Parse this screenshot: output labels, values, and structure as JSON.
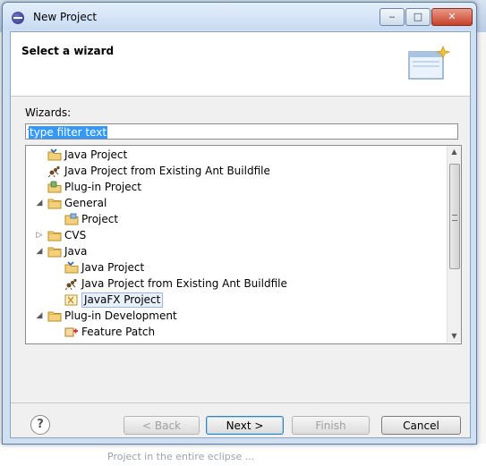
{
  "window": {
    "title": "New Project",
    "controls": {
      "minimize": "‒",
      "maximize": "□",
      "close": "✕"
    }
  },
  "background": {
    "bottom_text": "Project in the entire eclipse ..."
  },
  "header": {
    "title": "Select a wizard"
  },
  "wizards": {
    "label": "Wizards:",
    "filter_value": "type filter text"
  },
  "tree": {
    "items": [
      {
        "label": "Java Project",
        "icon": "java-project-icon",
        "level": 1,
        "expandable": false
      },
      {
        "label": "Java Project from Existing Ant Buildfile",
        "icon": "ant-project-icon",
        "level": 1,
        "expandable": false
      },
      {
        "label": "Plug-in Project",
        "icon": "plugin-project-icon",
        "level": 1,
        "expandable": false
      },
      {
        "label": "General",
        "icon": "folder-icon",
        "level": 1,
        "expandable": true,
        "expanded": true
      },
      {
        "label": "Project",
        "icon": "project-icon",
        "level": 2,
        "expandable": false
      },
      {
        "label": "CVS",
        "icon": "folder-icon",
        "level": 1,
        "expandable": true,
        "expanded": false
      },
      {
        "label": "Java",
        "icon": "folder-icon",
        "level": 1,
        "expandable": true,
        "expanded": true
      },
      {
        "label": "Java Project",
        "icon": "java-project-icon",
        "level": 2,
        "expandable": false
      },
      {
        "label": "Java Project from Existing Ant Buildfile",
        "icon": "ant-project-icon",
        "level": 2,
        "expandable": false
      },
      {
        "label": "JavaFX Project",
        "icon": "javafx-project-icon",
        "level": 2,
        "expandable": false,
        "selected": true
      },
      {
        "label": "Plug-in Development",
        "icon": "folder-icon",
        "level": 1,
        "expandable": true,
        "expanded": true
      },
      {
        "label": "Feature Patch",
        "icon": "feature-patch-icon",
        "level": 2,
        "expandable": false
      }
    ]
  },
  "buttons": {
    "help": "?",
    "back": "< Back",
    "next": "Next >",
    "finish": "Finish",
    "cancel": "Cancel"
  },
  "colors": {
    "selection": "#3399ff",
    "tree_selected_bg": "#e8f0fb",
    "title_bar": "#c9dbf2"
  }
}
